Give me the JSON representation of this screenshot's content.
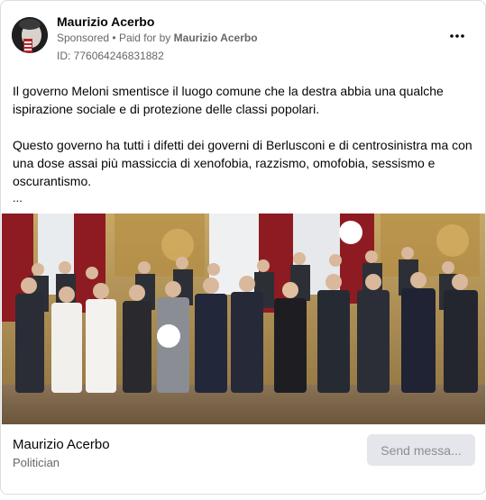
{
  "header": {
    "page_name": "Maurizio Acerbo",
    "sponsored_label": "Sponsored",
    "separator": "•",
    "paid_for_prefix": "Paid for by",
    "paid_for_name": "Maurizio Acerbo",
    "ad_id": "ID: 776064246831882",
    "more_icon": "more-horizontal-icon"
  },
  "body": {
    "paragraph_1": "Il governo Meloni smentisce il luogo comune che la destra abbia una qualche ispirazione sociale e di protezione delle classi popolari.",
    "paragraph_2": "Questo governo ha tutti i difetti dei governi di Berlusconi e di centrosinistra ma con una dose assai più massiccia di xenofobia, razzismo, omofobia, sessismo e oscurantismo.",
    "ellipsis": "..."
  },
  "footer": {
    "title": "Maurizio Acerbo",
    "subtitle": "Politician",
    "cta_label": "Send messa..."
  },
  "colors": {
    "secondary_text": "#65676b",
    "button_bg": "#e4e6eb",
    "curtain_red": "#8e1b22",
    "wall_gold": "#b7924d"
  }
}
